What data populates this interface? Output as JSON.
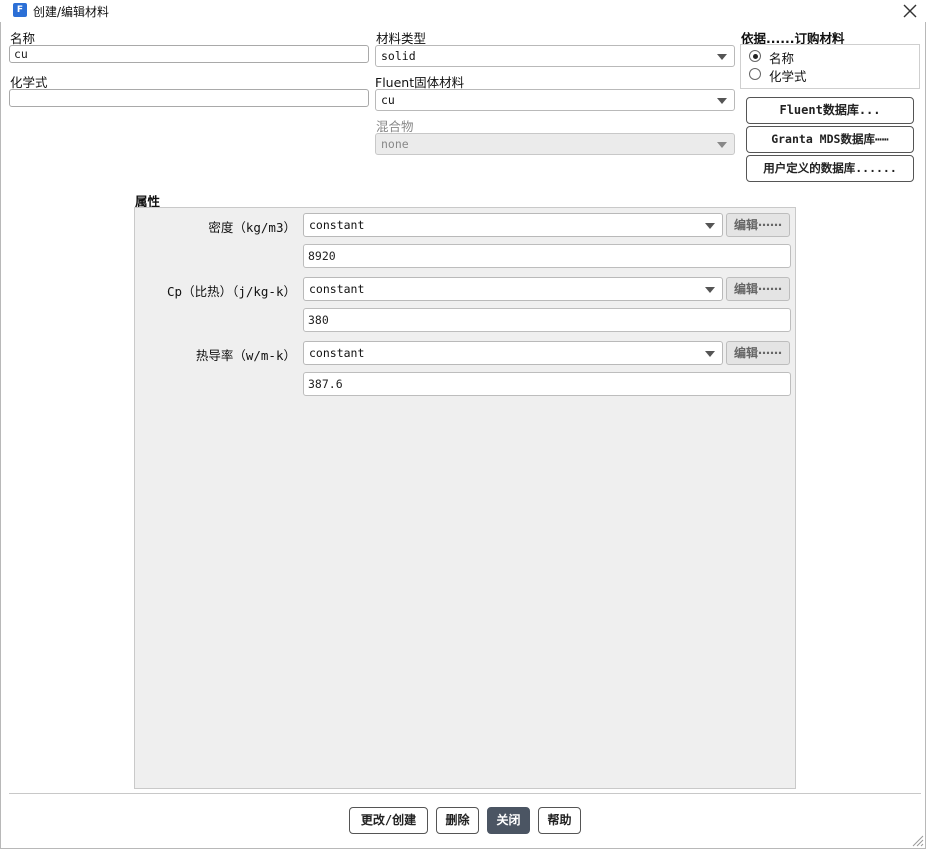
{
  "window": {
    "title": "创建/编辑材料",
    "app_icon": "F"
  },
  "name": {
    "label": "名称",
    "value": "cu"
  },
  "formula": {
    "label": "化学式",
    "value": ""
  },
  "material_type": {
    "label": "材料类型",
    "value": "solid"
  },
  "fluent_solid": {
    "label": "Fluent固体材料",
    "value": "cu"
  },
  "mixture": {
    "label": "混合物",
    "value": "none"
  },
  "order_by": {
    "label": "依据......订购材料",
    "options": [
      "名称",
      "化学式"
    ],
    "selected": "名称"
  },
  "databases": {
    "fluent": "Fluent数据库...",
    "granta": "Granta MDS数据库⋯⋯",
    "user": "用户定义的数据库......"
  },
  "properties": {
    "title": "属性",
    "rows": [
      {
        "label": "密度（kg/m3）",
        "method": "constant",
        "edit": "编辑⋯⋯",
        "value": "8920"
      },
      {
        "label": "Cp（比热）（j/kg-k）",
        "method": "constant",
        "edit": "编辑⋯⋯",
        "value": "380"
      },
      {
        "label": "热导率（w/m-k）",
        "method": "constant",
        "edit": "编辑⋯⋯",
        "value": "387.6"
      }
    ]
  },
  "footer": {
    "change_create": "更改/创建",
    "delete": "删除",
    "close": "关闭",
    "help": "帮助"
  }
}
